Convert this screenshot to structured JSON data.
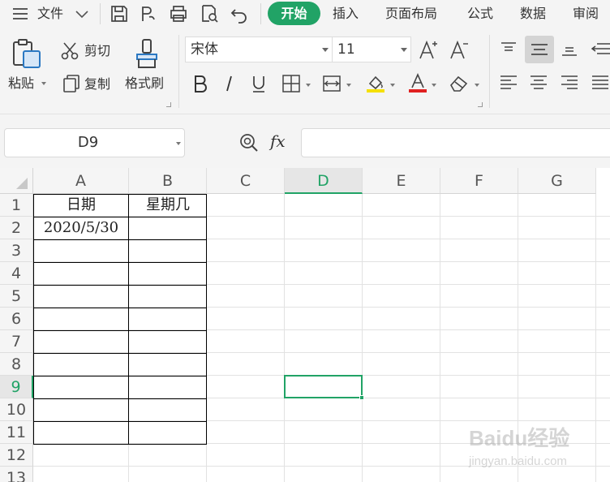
{
  "menubar": {
    "file_label": "文件",
    "tabs": [
      "开始",
      "插入",
      "页面布局",
      "公式",
      "数据",
      "审阅"
    ],
    "active_tab": "开始"
  },
  "ribbon": {
    "paste_label": "粘贴",
    "cut_label": "剪切",
    "copy_label": "复制",
    "format_painter_label": "格式刷",
    "font_name": "宋体",
    "font_size": "11",
    "font_color": "#e02020",
    "fill_color": "#f5e000"
  },
  "formula_bar": {
    "name_box": "D9",
    "fx_label": "fx",
    "formula": ""
  },
  "grid": {
    "columns": [
      "A",
      "B",
      "C",
      "D",
      "E",
      "F",
      "G"
    ],
    "rows": [
      "1",
      "2",
      "3",
      "4",
      "5",
      "6",
      "7",
      "8",
      "9",
      "10",
      "11",
      "12",
      "13"
    ],
    "active_column": "D",
    "active_row": "9",
    "cells": {
      "A1": "日期",
      "B1": "星期几",
      "A2": "2020/5/30"
    }
  },
  "watermark": {
    "main": "Baidu经验",
    "sub": "jingyan.baidu.com"
  },
  "colors": {
    "accent": "#21a366"
  }
}
